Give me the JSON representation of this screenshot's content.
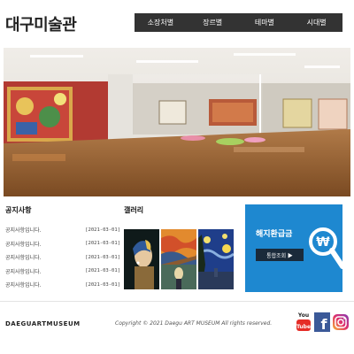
{
  "header": {
    "logo_text": "대구미술관",
    "nav": [
      "소장처별",
      "장르별",
      "테마별",
      "시대별"
    ]
  },
  "notice": {
    "title": "공지사항",
    "items": [
      {
        "text": "공지사항입니다.",
        "date": "[2021-03-01]"
      },
      {
        "text": "공지사항입니다.",
        "date": "[2021-03-01]"
      },
      {
        "text": "공지사항입니다.",
        "date": "[2021-03-01]"
      },
      {
        "text": "공지사항입니다.",
        "date": "[2021-03-01]"
      },
      {
        "text": "공지사항입니다.",
        "date": "[2021-03-01]"
      }
    ]
  },
  "gallery": {
    "title": "갤러리",
    "thumbs": [
      "girl-with-pearl-earring",
      "the-scream",
      "starry-night"
    ]
  },
  "refund": {
    "title": "해지환급금",
    "button": "통합조회 ▶",
    "color": "#1e88d0",
    "icon": "search-won-icon"
  },
  "footer": {
    "logo": "DAEGUARTMUSEUM",
    "copyright": "Copyright © 2021 Daegu ART MUSEUM All rights reserved.",
    "socials": [
      "youtube-icon",
      "facebook-icon",
      "instagram-icon"
    ]
  }
}
